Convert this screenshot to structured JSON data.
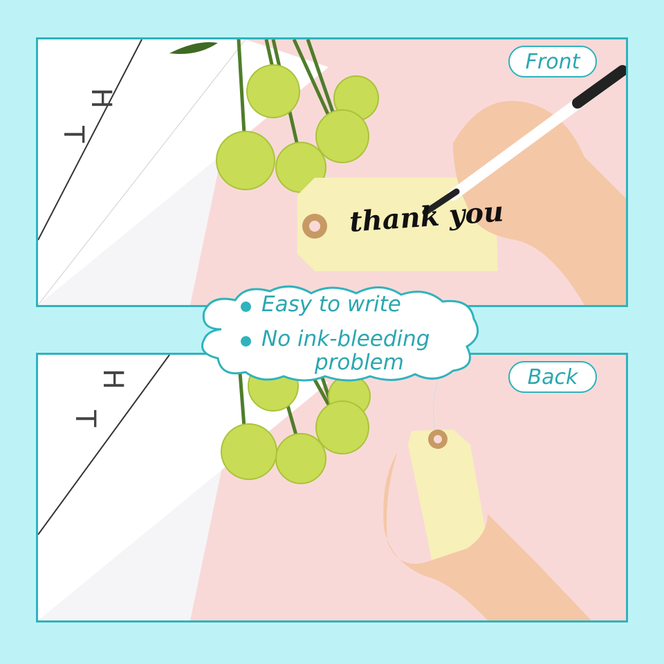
{
  "badges": {
    "front": "Front",
    "back": "Back"
  },
  "features": {
    "item1": "Easy to write",
    "item2_line1": "No ink-bleeding",
    "item2_line2": "problem"
  },
  "tag_writing": "thank you",
  "colors": {
    "accent": "#2fb3bc",
    "background": "#bdf3f7",
    "pink": "#f9d9d8",
    "tag": "#f7f0b9"
  }
}
